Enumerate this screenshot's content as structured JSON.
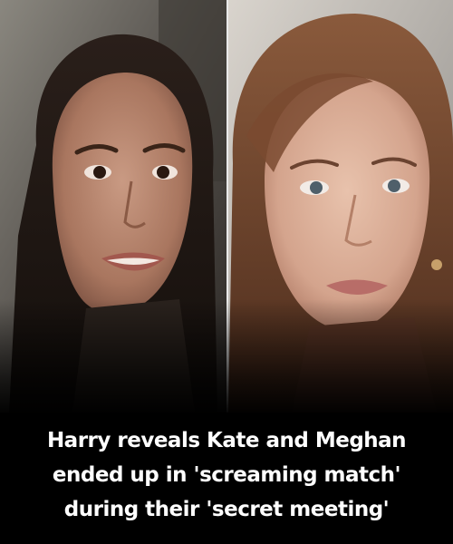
{
  "headline": {
    "line1": "Harry reveals Kate and Meghan",
    "line2": "ended up in 'screaming match'",
    "line3": "during their 'secret meeting'"
  },
  "colors": {
    "background": "#000000",
    "headline_text": "#ffffff",
    "divider": "#e9e9e9"
  },
  "images": {
    "left_photo": "portrait-photo",
    "right_photo": "portrait-photo"
  }
}
